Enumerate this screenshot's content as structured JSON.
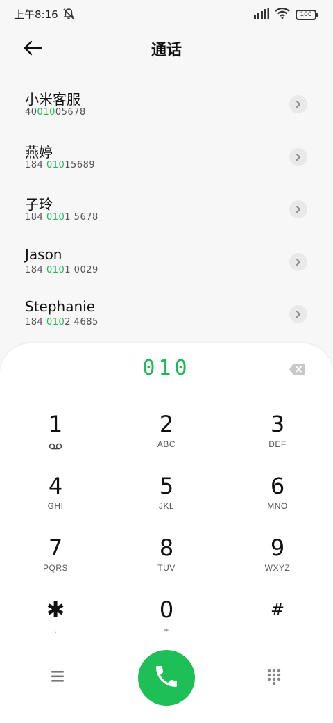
{
  "status": {
    "time": "上午8:16",
    "battery": "100"
  },
  "header": {
    "title": "通话"
  },
  "contacts": [
    {
      "name": "小米客服",
      "num_before": "40",
      "num_match": "010",
      "num_after": "05678"
    },
    {
      "name": "燕婷",
      "num_before": "184 ",
      "num_match": "010",
      "num_after": "15689"
    },
    {
      "name": "子玲",
      "num_before": "184 ",
      "num_match": "010",
      "num_after": "1 5678"
    },
    {
      "name": "Jason",
      "num_before": "184 ",
      "num_match": "010",
      "num_after": "1 0029"
    },
    {
      "name": "Stephanie",
      "num_before": "184 ",
      "num_match": "010",
      "num_after": "2 4685"
    }
  ],
  "dialer": {
    "input": "010",
    "keys": [
      {
        "digit": "1",
        "letters": ""
      },
      {
        "digit": "2",
        "letters": "ABC"
      },
      {
        "digit": "3",
        "letters": "DEF"
      },
      {
        "digit": "4",
        "letters": "GHI"
      },
      {
        "digit": "5",
        "letters": "JKL"
      },
      {
        "digit": "6",
        "letters": "MNO"
      },
      {
        "digit": "7",
        "letters": "PQRS"
      },
      {
        "digit": "8",
        "letters": "TUV"
      },
      {
        "digit": "9",
        "letters": "WXYZ"
      },
      {
        "digit": "✱",
        "letters": ","
      },
      {
        "digit": "0",
        "letters": "+"
      },
      {
        "digit": "#",
        "letters": ""
      }
    ]
  },
  "icons": {
    "back": "back-arrow-icon",
    "mute": "bell-muted-icon",
    "signal": "signal-icon",
    "wifi": "wifi-icon",
    "voicemail": "voicemail-icon",
    "backspace": "backspace-icon",
    "menu": "menu-icon",
    "call": "phone-icon",
    "keypad": "dialpad-icon"
  },
  "colors": {
    "accent": "#1db954",
    "call_button": "#1fbf58",
    "background": "#f7f7f7"
  }
}
